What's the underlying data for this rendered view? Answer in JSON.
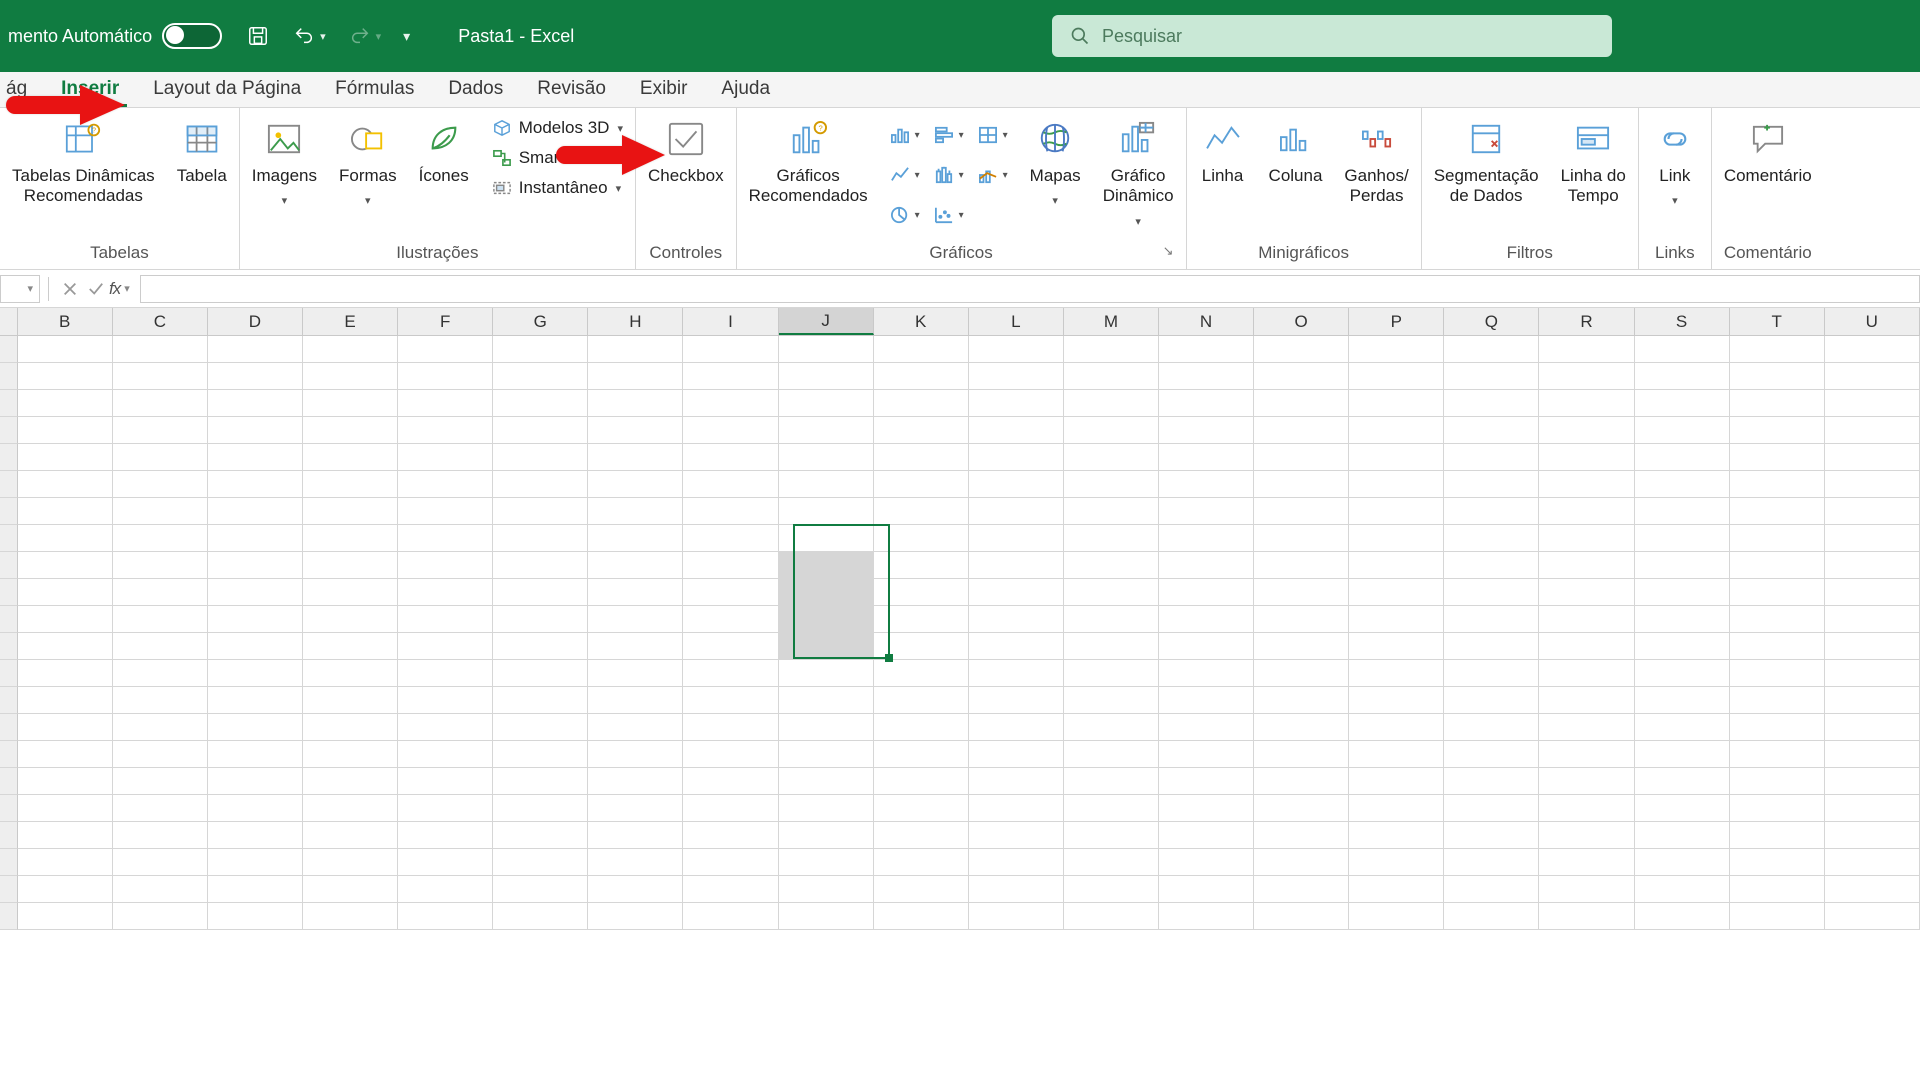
{
  "titlebar": {
    "autosave_label": "mento Automático",
    "doc_title": "Pasta1  -  Excel",
    "search_placeholder": "Pesquisar"
  },
  "tabs": {
    "file_partial": "ág",
    "inserir": "Inserir",
    "layout": "Layout da Página",
    "formulas": "Fórmulas",
    "dados": "Dados",
    "revisao": "Revisão",
    "exibir": "Exibir",
    "ajuda": "Ajuda"
  },
  "ribbon": {
    "tabelas": {
      "pivot": "Tabelas Dinâmicas\nRecomendadas",
      "tabela": "Tabela",
      "group_label": "Tabelas"
    },
    "ilustracoes": {
      "imagens": "Imagens",
      "formas": "Formas",
      "icones": "Ícones",
      "modelos3d": "Modelos 3D",
      "smartart": "SmartArt",
      "instantaneo": "Instantâneo",
      "group_label": "Ilustrações"
    },
    "controles": {
      "checkbox": "Checkbox",
      "group_label": "Controles"
    },
    "graficos": {
      "recomendados": "Gráficos\nRecomendados",
      "mapas": "Mapas",
      "dinamico": "Gráfico\nDinâmico",
      "group_label": "Gráficos"
    },
    "mini": {
      "linha": "Linha",
      "coluna": "Coluna",
      "ganhos": "Ganhos/\nPerdas",
      "group_label": "Minigráficos"
    },
    "filtros": {
      "seg": "Segmentação\nde Dados",
      "tempo": "Linha do\nTempo",
      "group_label": "Filtros"
    },
    "links": {
      "link": "Link",
      "group_label": "Links"
    },
    "coment": {
      "comentario": "Comentário",
      "group_label": "Comentário"
    }
  },
  "namebox_value": "",
  "formula_value": "",
  "columns": [
    "B",
    "C",
    "D",
    "E",
    "F",
    "G",
    "H",
    "I",
    "J",
    "K",
    "L",
    "M",
    "N",
    "O",
    "P",
    "Q",
    "R",
    "S",
    "T",
    "U"
  ],
  "selected_column": "J",
  "selection": {
    "col_index": 8,
    "row_start": 8,
    "row_end": 12
  },
  "row_count": 22
}
